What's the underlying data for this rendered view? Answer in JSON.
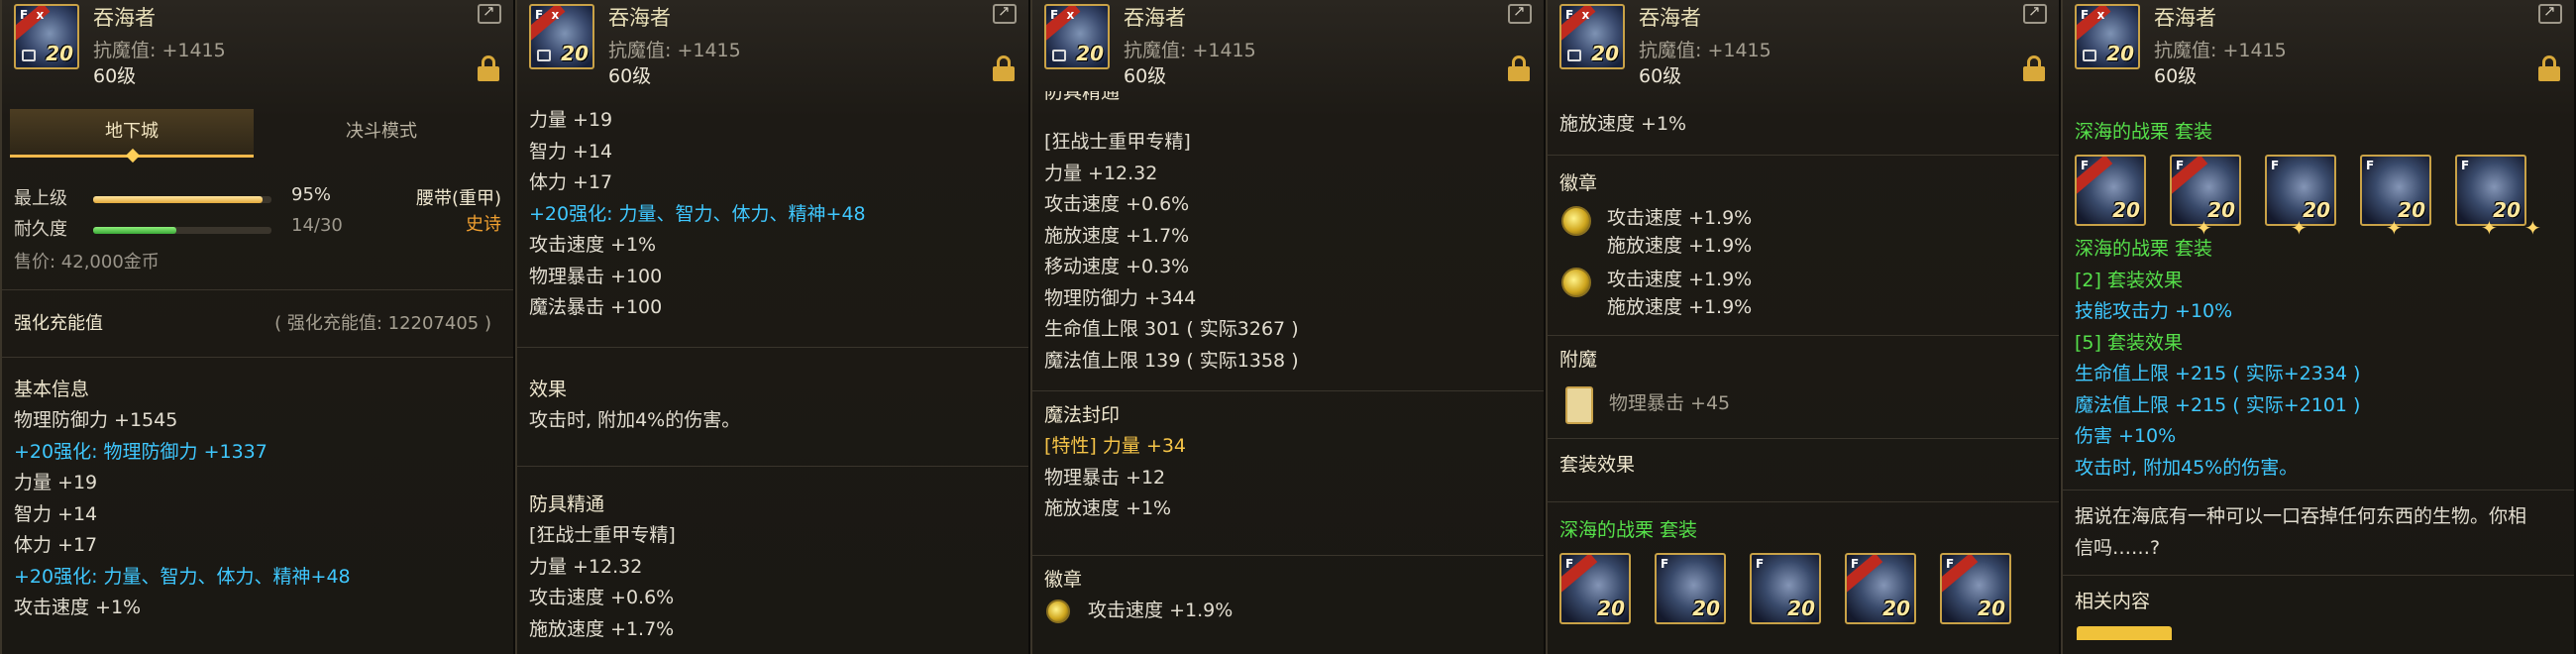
{
  "item": {
    "name": "吞海者",
    "attr": "抗魔值: +1415",
    "level": "60级",
    "icon_level": "20",
    "icon_fx": "F  x"
  },
  "p1": {
    "tab_dungeon": "地下城",
    "tab_duel": "决斗模式",
    "grade_label": "最上级",
    "grade_value": "95%",
    "grade_fraction": 0.95,
    "durability_label": "耐久度",
    "durability_value": "14/30",
    "durability_fraction": 0.4667,
    "slot_type": "腰带(重甲)",
    "rarity": "史诗",
    "price": "售价: 42,000金币",
    "reinforce_label": "强化充能值",
    "reinforce_value": "( 强化充能值: 12207405 )",
    "basic_title": "基本信息",
    "lines": [
      {
        "text": "物理防御力 +1545",
        "color": "white"
      },
      {
        "text": "+20强化: 物理防御力 +1337",
        "color": "blue"
      },
      {
        "text": "力量 +19",
        "color": "white"
      },
      {
        "text": "智力 +14",
        "color": "white"
      },
      {
        "text": "体力 +17",
        "color": "white"
      },
      {
        "text": "+20强化: 力量、智力、体力、精神+48",
        "color": "blue"
      },
      {
        "text": "攻击速度 +1%",
        "color": "white"
      }
    ]
  },
  "p2": {
    "lines": [
      "力量 +19",
      "智力 +14",
      "体力 +17",
      "+20强化: 力量、智力、体力、精神+48",
      "攻击速度 +1%",
      "物理暴击 +100",
      "魔法暴击 +100"
    ],
    "effect_title": "效果",
    "effect_text": "攻击时, 附加4%的伤害。",
    "armor_title": "防具精通",
    "armor_lines": [
      "[狂战士重甲专精]",
      "力量 +12.32",
      "攻击速度 +0.6%",
      "施放速度 +1.7%"
    ]
  },
  "p3": {
    "top_cut": "防具精通",
    "lines": [
      "[狂战士重甲专精]",
      "力量 +12.32",
      "攻击速度 +0.6%",
      "施放速度 +1.7%",
      "移动速度 +0.3%",
      "物理防御力 +344",
      "生命值上限 301 ( 实际3267 )",
      "魔法值上限 139 ( 实际1358 )"
    ],
    "seal_title": "魔法封印",
    "seal_trait": "[特性] 力量 +34",
    "seal_lines": [
      "物理暴击 +12",
      "施放速度 +1%"
    ],
    "emblem_title": "徽章",
    "emblem_line": "攻击速度 +1.9%"
  },
  "p4": {
    "top_line": "施放速度 +1%",
    "emblem_title": "徽章",
    "emblems": [
      {
        "a": "攻击速度 +1.9%",
        "b": "施放速度 +1.9%"
      },
      {
        "a": "攻击速度 +1.9%",
        "b": "施放速度 +1.9%"
      }
    ],
    "enchant_title": "附魔",
    "enchant_line": "物理暴击 +45",
    "set_title": "套装效果",
    "set_name": "深海的战栗 套装",
    "set_level": "20"
  },
  "p5": {
    "set_name": "深海的战栗 套装",
    "set_level": "20",
    "set_name2": "深海的战栗 套装",
    "bonus2_title": "[2] 套装效果",
    "bonus2_line": "技能攻击力 +10%",
    "bonus5_title": "[5] 套装效果",
    "bonus5_lines": [
      "生命值上限 +215 ( 实际+2334 )",
      "魔法值上限 +215 ( 实际+2101 )",
      "伤害 +10%",
      "攻击时, 附加45%的伤害。"
    ],
    "lore_1": "据说在海底有一种可以一口吞掉任何东西的生物。你相",
    "lore_2": "信吗……?",
    "related_title": "相关内容"
  },
  "colors": {
    "accent_gold": "#f5c448",
    "reinforce_blue": "#3fc8ff",
    "set_green": "#56e04a",
    "rarity_orange": "#f0a030"
  }
}
